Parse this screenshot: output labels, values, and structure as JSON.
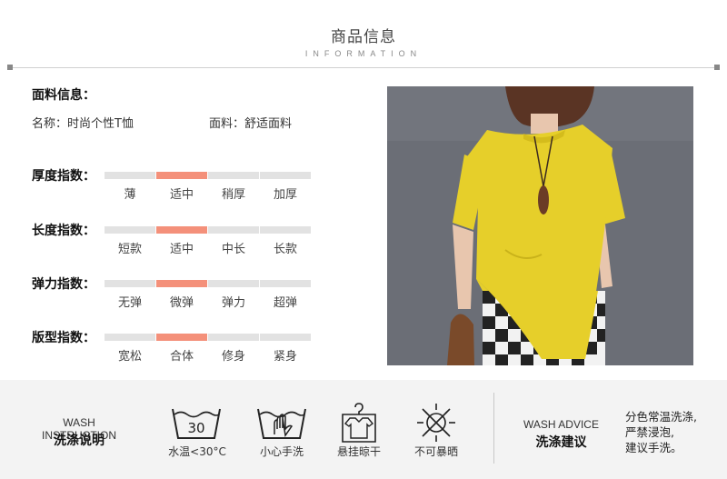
{
  "header": {
    "title": "商品信息",
    "subtitle": "INFORMATION"
  },
  "fabric": {
    "title": "面料信息：",
    "name_line": "名称：时尚个性T恤",
    "material_line": "面料：舒适面料"
  },
  "indices": [
    {
      "label": "厚度指数：",
      "options": [
        "薄",
        "适中",
        "稍厚",
        "加厚"
      ],
      "selected": 1
    },
    {
      "label": "长度指数：",
      "options": [
        "短款",
        "适中",
        "中长",
        "长款"
      ],
      "selected": 1
    },
    {
      "label": "弹力指数：",
      "options": [
        "无弹",
        "微弹",
        "弹力",
        "超弹"
      ],
      "selected": 1
    },
    {
      "label": "版型指数：",
      "options": [
        "宽松",
        "合体",
        "修身",
        "紧身"
      ],
      "selected": 1
    }
  ],
  "colors": {
    "accent": "#f4907a",
    "track": "#e2e2e2",
    "shirt": "#e6cf2a",
    "backdrop": "#6a6d75"
  },
  "wash": {
    "title_en": "WASH INSTRUCTION",
    "title_cn": "洗涤说明",
    "items": [
      {
        "icon": "wash-30-icon",
        "icon_text": "30",
        "label": "水温<30°C"
      },
      {
        "icon": "hand-wash-icon",
        "label": "小心手洗"
      },
      {
        "icon": "hang-dry-icon",
        "label": "悬挂晾干"
      },
      {
        "icon": "no-sun-icon",
        "label": "不可暴晒"
      }
    ]
  },
  "advice": {
    "title_en": "WASH ADVICE",
    "title_cn": "洗涤建议",
    "lines": [
      "分色常温洗涤,",
      "严禁浸泡,",
      "建议手洗。"
    ]
  }
}
